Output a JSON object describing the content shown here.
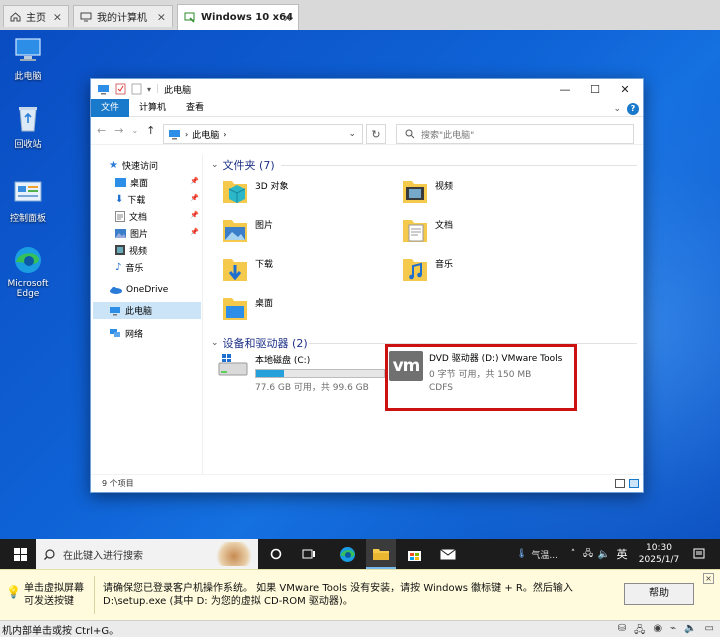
{
  "vm_tabs": [
    {
      "label": "主页"
    },
    {
      "label": "我的计算机"
    },
    {
      "label": "Windows 10 x64"
    }
  ],
  "desktop_icons": [
    {
      "label": "此电脑"
    },
    {
      "label": "回收站"
    },
    {
      "label": "控制面板"
    },
    {
      "label": "Microsoft Edge"
    }
  ],
  "explorer": {
    "title": "此电脑",
    "ribbon_tabs": [
      "文件",
      "计算机",
      "查看"
    ],
    "address_path": "此电脑",
    "search_placeholder": "搜索\"此电脑\"",
    "nav": {
      "quick_access": "快速访问",
      "items": [
        "桌面",
        "下载",
        "文档",
        "图片",
        "视频",
        "音乐"
      ],
      "onedrive": "OneDrive",
      "this_pc": "此电脑",
      "network": "网络"
    },
    "folders_header": "文件夹 (7)",
    "folders": [
      "3D 对象",
      "视频",
      "图片",
      "文档",
      "下载",
      "音乐",
      "桌面"
    ],
    "drives_header": "设备和驱动器 (2)",
    "drives": [
      {
        "name": "本地磁盘 (C:)",
        "detail": "77.6 GB 可用，共 99.6 GB",
        "used_fraction": 0.22
      },
      {
        "name": "DVD 驱动器 (D:) VMware Tools",
        "detail": "0 字节 可用，共 150 MB",
        "fs": "CDFS",
        "icon_text": "vm"
      }
    ],
    "status_text": "9 个项目",
    "highlight_color": "#cc1111"
  },
  "taskbar": {
    "search_placeholder": "在此键入进行搜索",
    "weather_text": "气温...",
    "ime": "英",
    "time": "10:30",
    "date": "2025/1/7"
  },
  "notice": {
    "left_line1": "单击虚拟屏幕",
    "left_line2": "可发送按键",
    "message_line1": "请确保您已登录客户机操作系统。 如果 VMware Tools 没有安装，请按 Windows 徽标键 + R。然后输入",
    "message_line2": "D:\\setup.exe (其中 D: 为您的虚拟 CD-ROM 驱动器)。",
    "help_button": "帮助"
  },
  "vm_status": "机内部单击或按 Ctrl+G。"
}
